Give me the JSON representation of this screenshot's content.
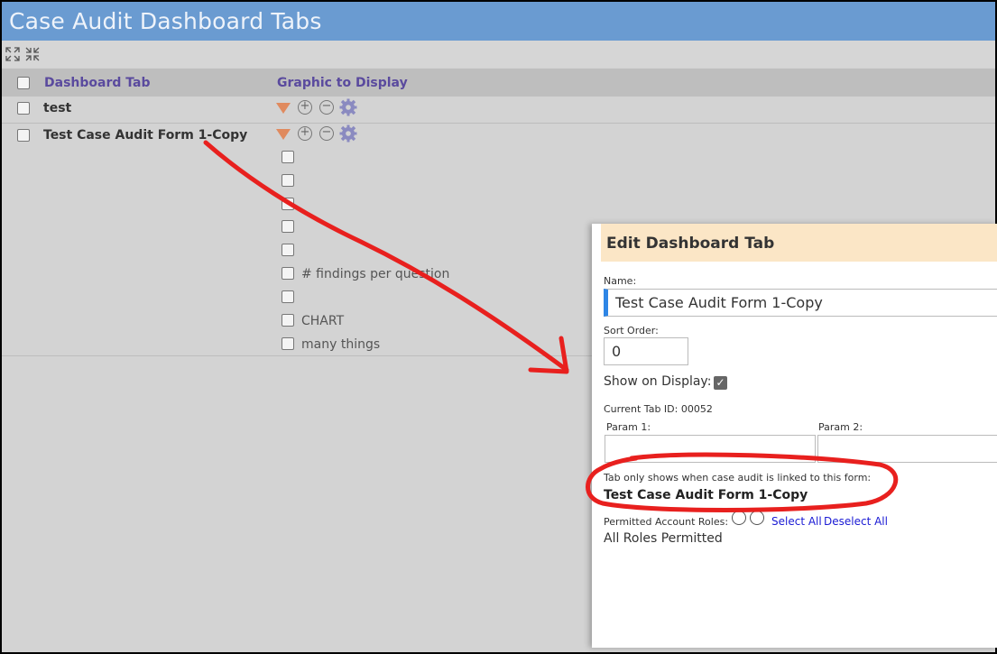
{
  "page": {
    "title": "Case Audit Dashboard Tabs",
    "toolbar": {
      "expand_icon": "expand-arrows-icon",
      "collapse_icon": "collapse-arrows-icon"
    }
  },
  "table": {
    "columns": [
      "Dashboard Tab",
      "Graphic to Display"
    ],
    "rows": [
      {
        "label": "test"
      },
      {
        "label": "Test Case Audit Form 1-Copy"
      }
    ],
    "sub_items": [
      "",
      "",
      "",
      "",
      "",
      "# findings per question",
      "",
      "CHART",
      "many things"
    ]
  },
  "modal": {
    "title": "Edit Dashboard Tab",
    "name_label": "Name:",
    "name_value": "Test Case Audit Form 1-Copy",
    "sort_label": "Sort Order:",
    "sort_value": "0",
    "show_label": "Show on Display:",
    "show_checked": true,
    "tab_id_text": "Current Tab ID: 00052",
    "param1_label": "Param 1:",
    "param2_label": "Param 2:",
    "param1_value": "",
    "param2_value": "",
    "linked_note": "Tab only shows when case audit is linked to this form:",
    "linked_form": "Test Case Audit Form 1-Copy",
    "roles_label": "Permitted Account Roles:",
    "select_all": "Select All",
    "deselect_all": "Deselect All",
    "roles_value": "All Roles Permitted"
  },
  "colors": {
    "title_bar": "#6a9bd1",
    "header_text": "#5a4a9e",
    "modal_header": "#fbe6c6",
    "annotation": "#e8201e",
    "link": "#1a1ad4"
  }
}
